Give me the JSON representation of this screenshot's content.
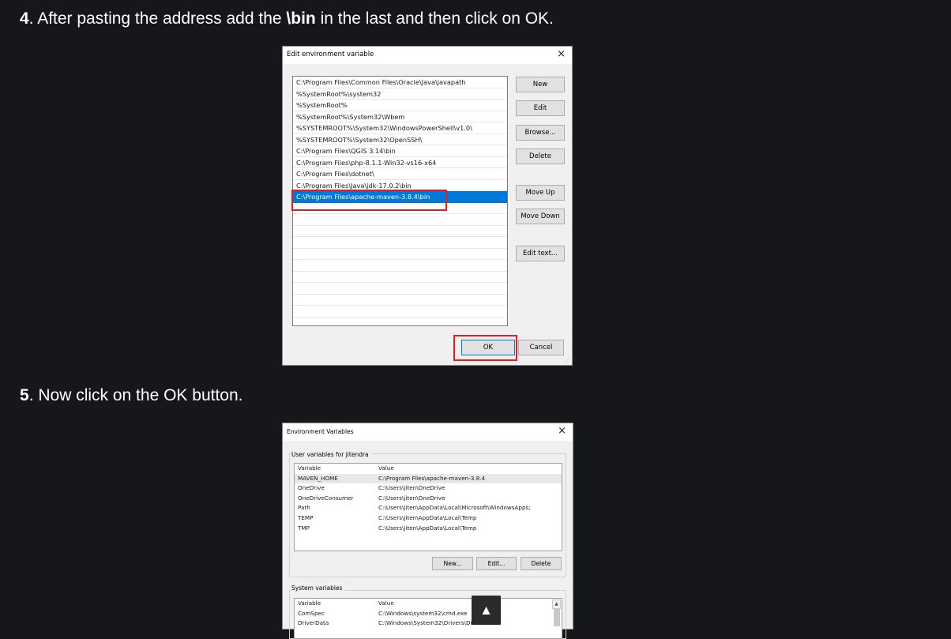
{
  "steps": {
    "step4": {
      "number": "4",
      "pre": ". After pasting the address add the ",
      "bold": "\\bin",
      "post": " in the last and then click on OK."
    },
    "step5": {
      "number": "5",
      "text": ". Now click on the OK button."
    }
  },
  "dialog1": {
    "title": "Edit environment variable",
    "close_icon": "×",
    "paths": [
      "C:\\Program Files\\Common Files\\Oracle\\Java\\javapath",
      "%SystemRoot%\\system32",
      "%SystemRoot%",
      "%SystemRoot%\\System32\\Wbem",
      "%SYSTEMROOT%\\System32\\WindowsPowerShell\\v1.0\\",
      "%SYSTEMROOT%\\System32\\OpenSSH\\",
      "C:\\Program Files\\QGIS 3.14\\bin",
      "C:\\Program Files\\php-8.1.1-Win32-vs16-x64",
      "C:\\Program Files\\dotnet\\",
      "C:\\Program Files\\Java\\jdk-17.0.2\\bin",
      "C:\\Program Files\\apache-maven-3.8.4\\bin"
    ],
    "selected_index": 10,
    "buttons": {
      "new": "New",
      "edit": "Edit",
      "browse": "Browse...",
      "delete": "Delete",
      "move_up": "Move Up",
      "move_down": "Move Down",
      "edit_text": "Edit text...",
      "ok": "OK",
      "cancel": "Cancel"
    }
  },
  "dialog2": {
    "title": "Environment Variables",
    "close_icon": "×",
    "user_section_label": "User variables for jitendra",
    "user_headers": {
      "variable": "Variable",
      "value": "Value"
    },
    "user_vars": [
      {
        "name": "MAVEN_HOME",
        "value": "C:\\Program Files\\apache-maven-3.8.4"
      },
      {
        "name": "OneDrive",
        "value": "C:\\Users\\jiten\\OneDrive"
      },
      {
        "name": "OneDriveConsumer",
        "value": "C:\\Users\\jiten\\OneDrive"
      },
      {
        "name": "Path",
        "value": "C:\\Users\\jiten\\AppData\\Local\\Microsoft\\WindowsApps;"
      },
      {
        "name": "TEMP",
        "value": "C:\\Users\\jiten\\AppData\\Local\\Temp"
      },
      {
        "name": "TMP",
        "value": "C:\\Users\\jiten\\AppData\\Local\\Temp"
      }
    ],
    "user_buttons": {
      "new": "New...",
      "edit": "Edit...",
      "delete": "Delete"
    },
    "system_section_label": "System variables",
    "system_headers": {
      "variable": "Variable",
      "value": "Value"
    },
    "system_vars": [
      {
        "name": "ComSpec",
        "value": "C:\\Windows\\system32\\cmd.exe"
      },
      {
        "name": "DriverData",
        "value": "C:\\Windows\\System32\\Drivers\\DriverData"
      }
    ]
  },
  "back_to_top": "▲"
}
